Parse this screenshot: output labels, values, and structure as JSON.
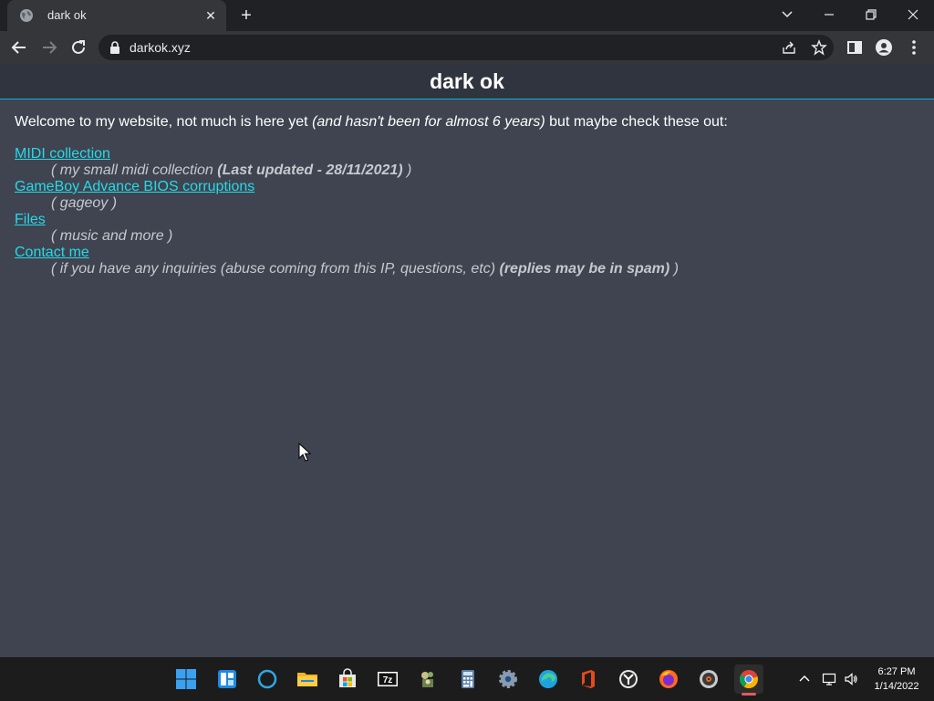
{
  "browser": {
    "tab_title": "dark ok",
    "url": "darkok.xyz"
  },
  "site": {
    "title": "dark ok",
    "intro_start": "Welcome to my website, not much is here yet ",
    "intro_italic": "(and hasn't been for almost 6 years)",
    "intro_end": " but maybe check these out:",
    "links": [
      {
        "label": "MIDI collection",
        "desc_start": "( my small midi collection ",
        "desc_bold": "(Last updated - 28/11/2021)",
        "desc_end": " )"
      },
      {
        "label": "GameBoy Advance BIOS corruptions",
        "desc_start": "( gageoy )",
        "desc_bold": "",
        "desc_end": ""
      },
      {
        "label": "Files",
        "desc_start": "( music and more )",
        "desc_bold": "",
        "desc_end": ""
      },
      {
        "label": "Contact me",
        "desc_start": "( if you have any inquiries (abuse coming from this IP, questions, etc) ",
        "desc_bold": "(replies may be in spam)",
        "desc_end": " )"
      }
    ]
  },
  "taskbar": {
    "apps": [
      "start-icon",
      "widgets-icon",
      "cortana-icon",
      "file-explorer-icon",
      "store-icon",
      "7zip-icon",
      "game-icon",
      "calculator-icon",
      "settings-icon",
      "edge-icon",
      "office-icon",
      "clock-app-icon",
      "firefox-icon",
      "media-player-icon",
      "chrome-icon"
    ],
    "time": "6:27 PM",
    "date": "1/14/2022"
  },
  "colors": {
    "page_bg": "#3f4450",
    "header_bg": "#30343e",
    "link": "#26d9e8",
    "accent_line": "#00bcd4"
  }
}
